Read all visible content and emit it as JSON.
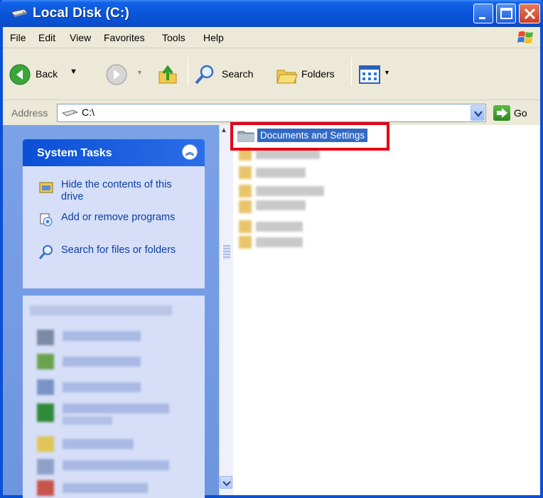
{
  "window": {
    "title": "Local Disk (C:)"
  },
  "menu": [
    "File",
    "Edit",
    "View",
    "Favorites",
    "Tools",
    "Help"
  ],
  "toolbar": {
    "back_label": "Back",
    "search_label": "Search",
    "folders_label": "Folders"
  },
  "address": {
    "label": "Address",
    "value": "C:\\",
    "go_label": "Go"
  },
  "system_tasks": {
    "title": "System Tasks",
    "items": [
      {
        "icon": "hide-drive-icon",
        "label": "Hide the contents of this drive"
      },
      {
        "icon": "add-remove-programs-icon",
        "label": "Add or remove programs"
      },
      {
        "icon": "search-icon",
        "label": "Search for files or folders"
      }
    ]
  },
  "content": {
    "items": [
      {
        "icon": "folder-icon",
        "label": "Documents and Settings",
        "selected": true
      }
    ]
  },
  "colors": {
    "titlebar": "#0a4fd6",
    "selection": "#316ac5",
    "highlight_box": "#e60012",
    "task_panel": "#d6dff7",
    "left_pane": "#7ba2e7"
  }
}
